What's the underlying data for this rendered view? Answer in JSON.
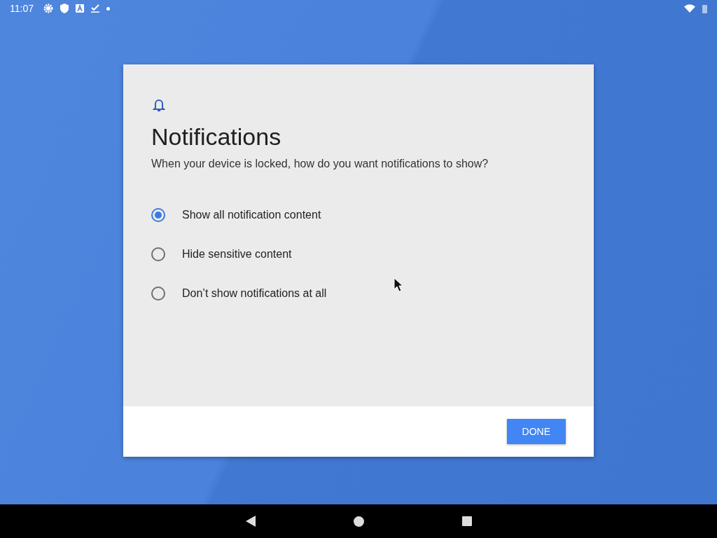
{
  "status_bar": {
    "time": "11:07"
  },
  "dialog": {
    "title": "Notifications",
    "subtitle": "When your device is locked, how do you want notifications to show?",
    "options": [
      {
        "label": "Show all notification content",
        "selected": true
      },
      {
        "label": "Hide sensitive content",
        "selected": false
      },
      {
        "label": "Don’t show notifications at all",
        "selected": false
      }
    ],
    "done_button": "DONE"
  }
}
